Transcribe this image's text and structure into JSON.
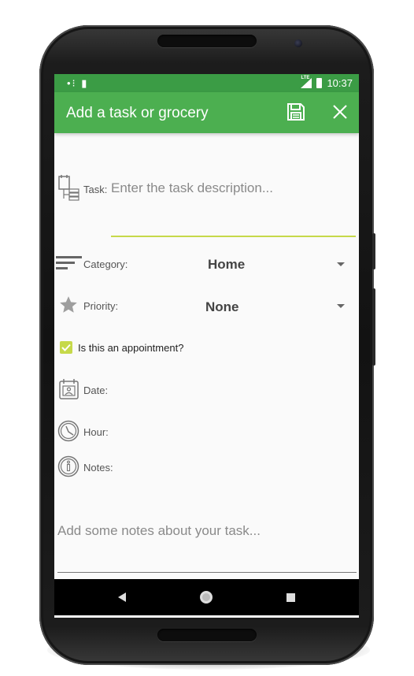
{
  "status_bar": {
    "left_icons": "•⁝ ▮",
    "time": "10:37",
    "network": "LTE"
  },
  "app_bar": {
    "title": "Add a task or grocery",
    "save_icon": "save-icon",
    "close_icon": "close-icon"
  },
  "form": {
    "task": {
      "label": "Task:",
      "placeholder": "Enter the task description..."
    },
    "category": {
      "label": "Category:",
      "value": "Home"
    },
    "priority": {
      "label": "Priority:",
      "value": "None"
    },
    "appointment": {
      "label": "Is this an appointment?",
      "checked": true
    },
    "date": {
      "label": "Date:"
    },
    "hour": {
      "label": "Hour:"
    },
    "notes": {
      "label": "Notes:",
      "placeholder": "Add some notes about your task..."
    }
  },
  "colors": {
    "status_bar": "#3b9c45",
    "app_bar": "#4caf50",
    "accent": "#c6d94a"
  },
  "nav_bar": {
    "back": "back-icon",
    "home": "home-icon",
    "recents": "recents-icon"
  }
}
